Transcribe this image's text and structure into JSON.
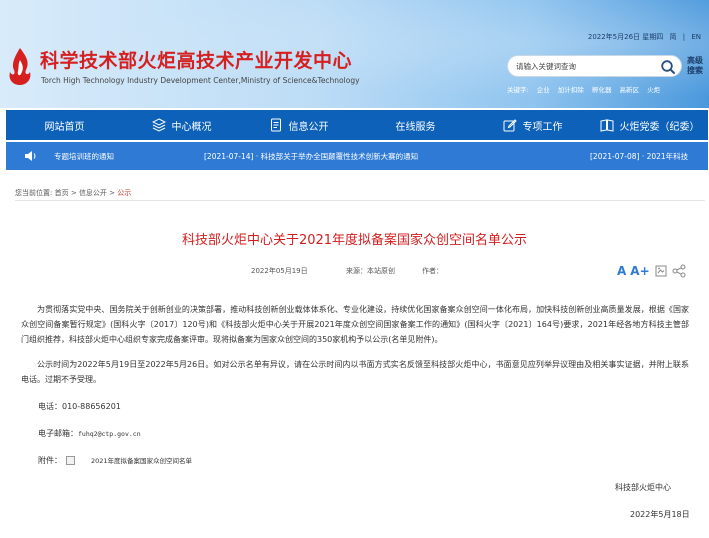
{
  "header": {
    "title": "科学技术部火炬高技术产业开发中心",
    "subtitle": "Torch High Technology Industry Development Center,Ministry of Science&Technology",
    "topbar": {
      "date": "2022年5月26日 星期四",
      "link_simplified": "简",
      "link_english": "EN"
    },
    "search": {
      "placeholder": "请输入关键词查询"
    },
    "advanced_search": "高级搜索",
    "keywords_label": "关键字:",
    "keywords": [
      "企业",
      "加计扣除",
      "孵化器",
      "高新区",
      "火炬"
    ]
  },
  "nav": {
    "items": [
      {
        "label": "网站首页",
        "icon": "none"
      },
      {
        "label": "中心概况",
        "icon": "layers-icon"
      },
      {
        "label": "信息公开",
        "icon": "document-icon"
      },
      {
        "label": "在线服务",
        "icon": "none"
      },
      {
        "label": "专项工作",
        "icon": "edit-icon"
      },
      {
        "label": "火炬党委（纪委）",
        "icon": "book-icon"
      }
    ]
  },
  "ticker": {
    "item1": "专题培训班的通知",
    "item2": "[2021-07-14] · 科技部关于举办全国颠覆性技术创新大赛的通知",
    "item3": "[2021-07-08] · 2021年科技"
  },
  "breadcrumb": {
    "label": "您当前位置:",
    "home": "首页",
    "sep": ">",
    "section": "信息公开",
    "current": "公示"
  },
  "article": {
    "title": "科技部火炬中心关于2021年度拟备案国家众创空间名单公示",
    "date": "2022年05月19日",
    "source": "来源：本站原创",
    "author": "作者：",
    "tools": {
      "font_small": "A",
      "font_large": "A+"
    },
    "para1": "为贯彻落实党中央、国务院关于创新创业的决策部署，推动科技创新创业载体体系化、专业化建设，持续优化国家备案众创空间一体化布局，加快科技创新创业高质量发展，根据《国家众创空间备案暂行规定》(国科火字〔2017〕120号)和《科技部火炬中心关于开展2021年度众创空间国家备案工作的通知》(国科火字〔2021〕164号)要求，2021年经各地方科技主管部门组织推荐，科技部火炬中心组织专家完成备案评审。现将拟备案为国家众创空间的350家机构予以公示(名单见附件)。",
    "para2": "公示时间为2022年5月19日至2022年5月26日。如对公示名单有异议，请在公示时间内以书面方式实名反馈至科技部火炬中心，书面意见应列举异议理由及相关事实证据，并附上联系电话。过期不予受理。",
    "phone": "电话：010-88656201",
    "email_label": "电子邮箱：",
    "email": "fuhq2@ctp.gov.cn",
    "attachment_label": "附件：",
    "attachment_name": "2021年度拟备案国家众创空间名单",
    "signature": "科技部火炬中心",
    "sign_date": "2022年5月18日"
  },
  "colors": {
    "title_red": "#d21e1e",
    "nav_blue": "#0d61b8",
    "ticker_blue": "#2f7ad4"
  }
}
